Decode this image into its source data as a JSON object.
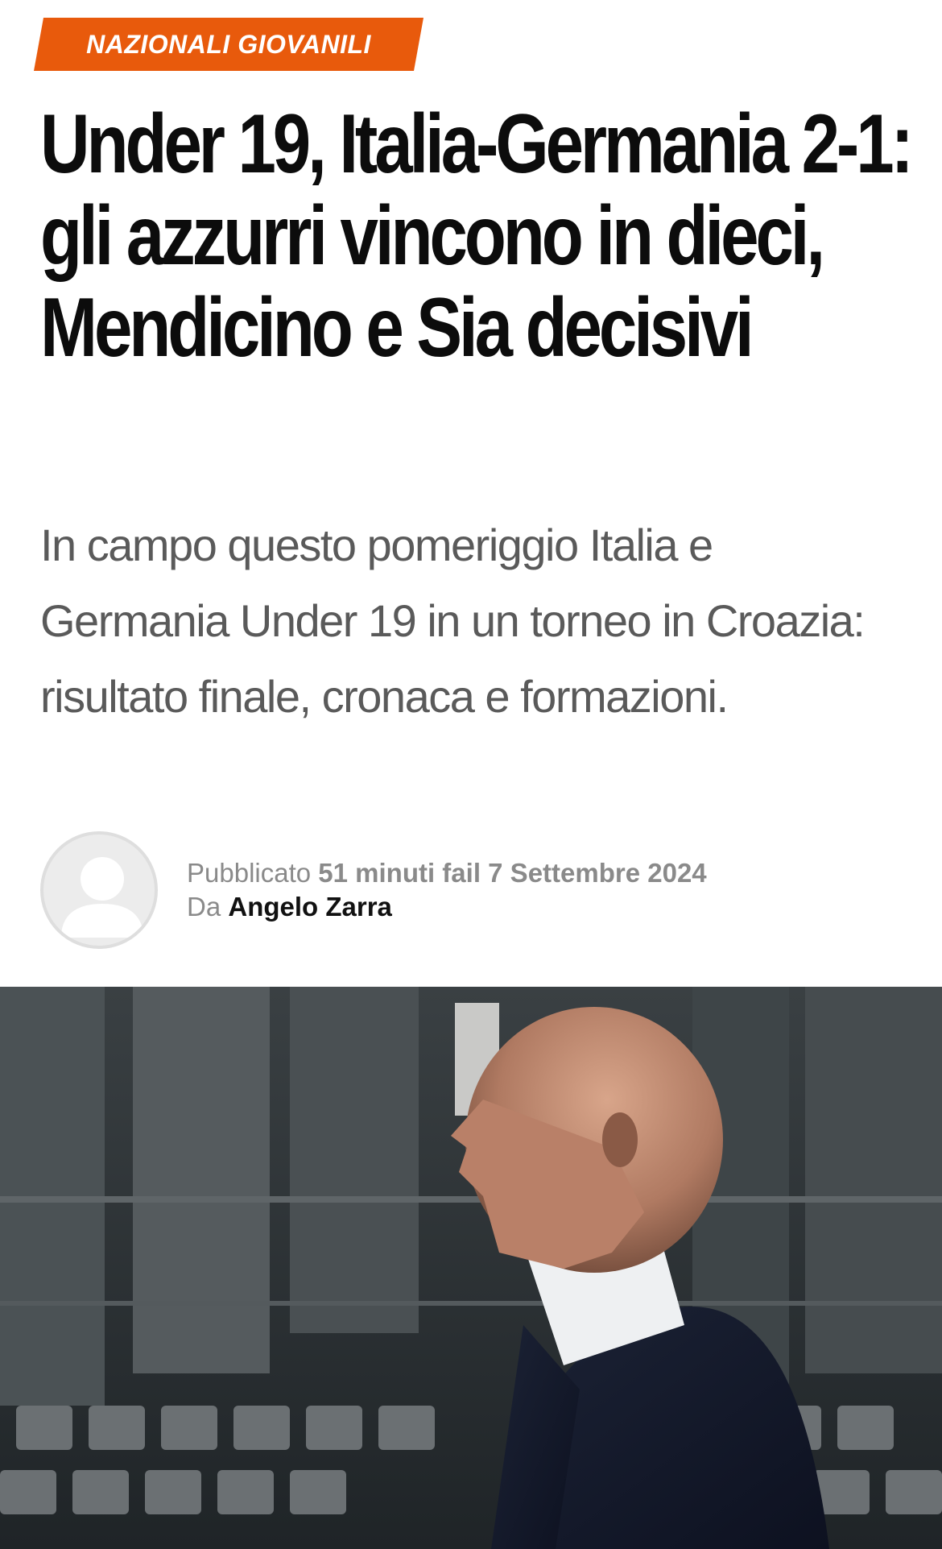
{
  "article": {
    "category": "NAZIONALI GIOVANILI",
    "headline": "Under 19, Italia-Germania 2-1: gli azzurri vincono in dieci, Mendicino e Sia decisivi",
    "subtitle": "In campo questo pomeriggio Italia e Germania Under 19 in un torneo in Croazia: risultato finale, cronaca e formazioni."
  },
  "meta": {
    "published_label": "Pubblicato",
    "published_relative": "51 minuti fa",
    "published_date": "il 7 Settembre 2024",
    "by_label": "Da",
    "author": "Angelo Zarra"
  },
  "icons": {
    "avatar": "user-placeholder-icon"
  },
  "colors": {
    "accent": "#e85a0c",
    "headline": "#0c0c0c",
    "subtitle": "#5a5a5a",
    "meta": "#8a8a8a"
  }
}
